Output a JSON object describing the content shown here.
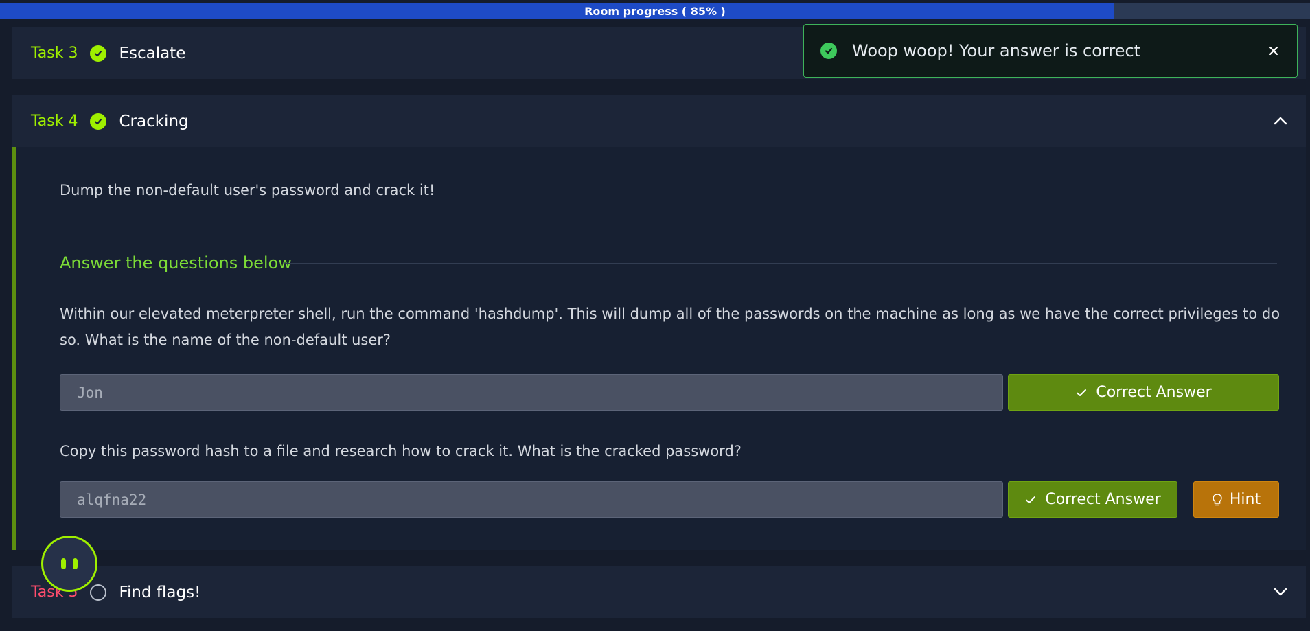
{
  "progress": {
    "label": "Room progress ( 85% )",
    "value": 85
  },
  "toast": {
    "message": "Woop woop! Your answer is correct",
    "icon": "check-circle-icon",
    "close_icon": "close-icon"
  },
  "tasks": [
    {
      "num": "Task 3",
      "title": "Escalate",
      "status": "done"
    },
    {
      "num": "Task 4",
      "title": "Cracking",
      "status": "done",
      "expanded": true
    },
    {
      "num": "Task 5",
      "title": "Find flags!",
      "status": "todo"
    }
  ],
  "task4": {
    "intro": "Dump the non-default user's password and crack it!",
    "section_title": "Answer the questions below",
    "questions": [
      {
        "text": "Within our elevated meterpreter shell, run the command 'hashdump'. This will dump all of the passwords on the machine as long as we have the correct privileges to do so. What is the name of the non-default user?",
        "answer": "Jon",
        "button": "Correct Answer"
      },
      {
        "text": "Copy this password hash to a file and research how to crack it. What is the cracked password?",
        "answer": "alqfna22",
        "button": "Correct Answer",
        "hint": "Hint"
      }
    ]
  },
  "colors": {
    "accent": "#9fef00",
    "progress": "#1e4bc6",
    "correct": "#5e8a10",
    "hint": "#b8730a",
    "pending": "#ff4d6d"
  }
}
